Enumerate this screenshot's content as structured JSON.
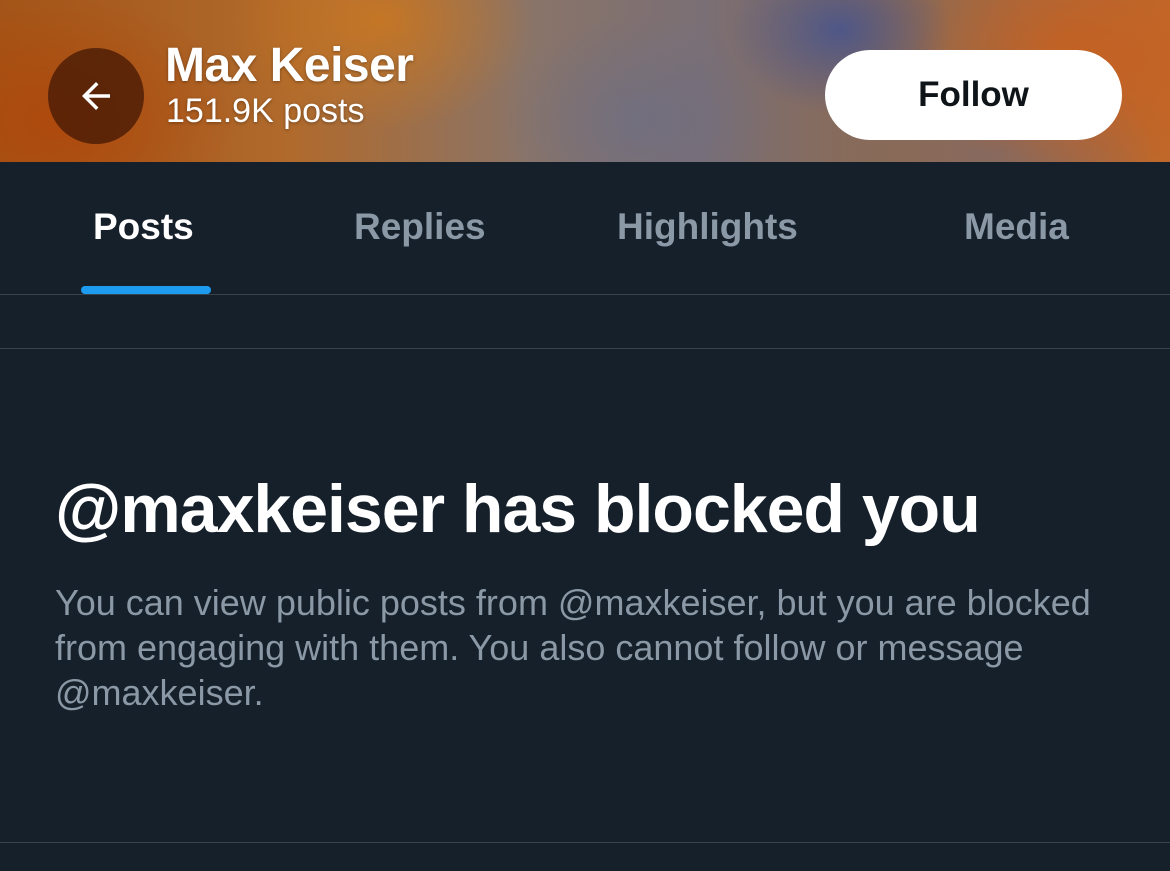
{
  "header": {
    "name": "Max Keiser",
    "post_count": "151.9K posts",
    "follow_label": "Follow",
    "back_icon": "arrow-left-icon"
  },
  "tabs": [
    {
      "label": "Posts",
      "active": true
    },
    {
      "label": "Replies",
      "active": false
    },
    {
      "label": "Highlights",
      "active": false
    },
    {
      "label": "Media",
      "active": false
    }
  ],
  "blocked": {
    "title": "@maxkeiser has blocked you",
    "message": "You can view public posts from @maxkeiser, but you are blocked from engaging with them. You also cannot follow or message @maxkeiser."
  },
  "colors": {
    "background": "#15202b",
    "accent": "#1d9bf0",
    "secondary_text": "#8b98a5",
    "divider": "#38444d"
  }
}
